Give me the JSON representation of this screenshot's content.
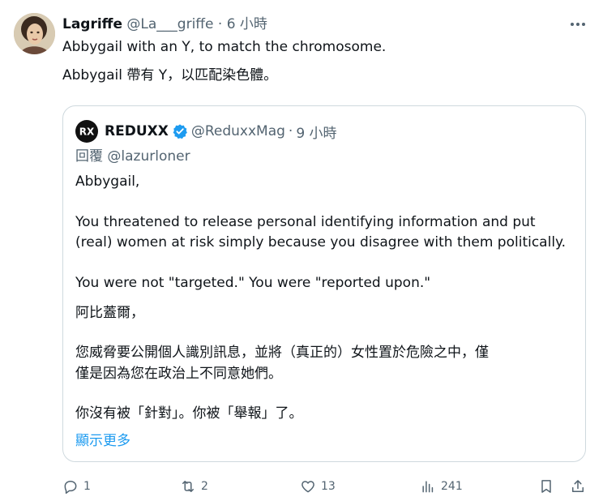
{
  "post": {
    "author_name": "Lagriffe",
    "author_handle": "@La___griffe",
    "separator": "·",
    "time": "6 小時",
    "line_1": "Abbygail with an Y, to match the chromosome.",
    "line_2": "Abbygail 帶有 Y，以匹配染色體。"
  },
  "quote": {
    "author_name": "REDUXX",
    "author_handle": "@ReduxxMag",
    "separator": "·",
    "time": "9 小時",
    "reply_to": "回覆 @lazurloner",
    "lines": [
      "Abbygail,",
      "You threatened to release personal identifying information and put",
      "(real) women at risk simply because you disagree with them politically.",
      "You were not \"targeted.\" You were \"reported upon.\"",
      "阿比蓋爾，",
      "您威脅要公開個人識別訊息，並將（真正的）女性置於危險之中，僅",
      "僅是因為您在政治上不同意她們。",
      "你沒有被「針對」。你被「舉報」了。"
    ],
    "show_more": "顯示更多"
  },
  "actions": {
    "replies": "1",
    "reposts": "2",
    "likes": "13",
    "views": "241"
  },
  "icons": {
    "more": "more-horizontal-icon",
    "reply": "reply-icon",
    "repost": "repost-icon",
    "like": "heart-icon",
    "views": "views-chart-icon",
    "bookmark": "bookmark-icon",
    "share": "share-icon",
    "verified": "verified-badge-icon"
  },
  "colors": {
    "text": "#0f1419",
    "secondary": "#536471",
    "link": "#1d9bf0",
    "border": "#cfd9de",
    "verified": "#1d9bf0"
  }
}
